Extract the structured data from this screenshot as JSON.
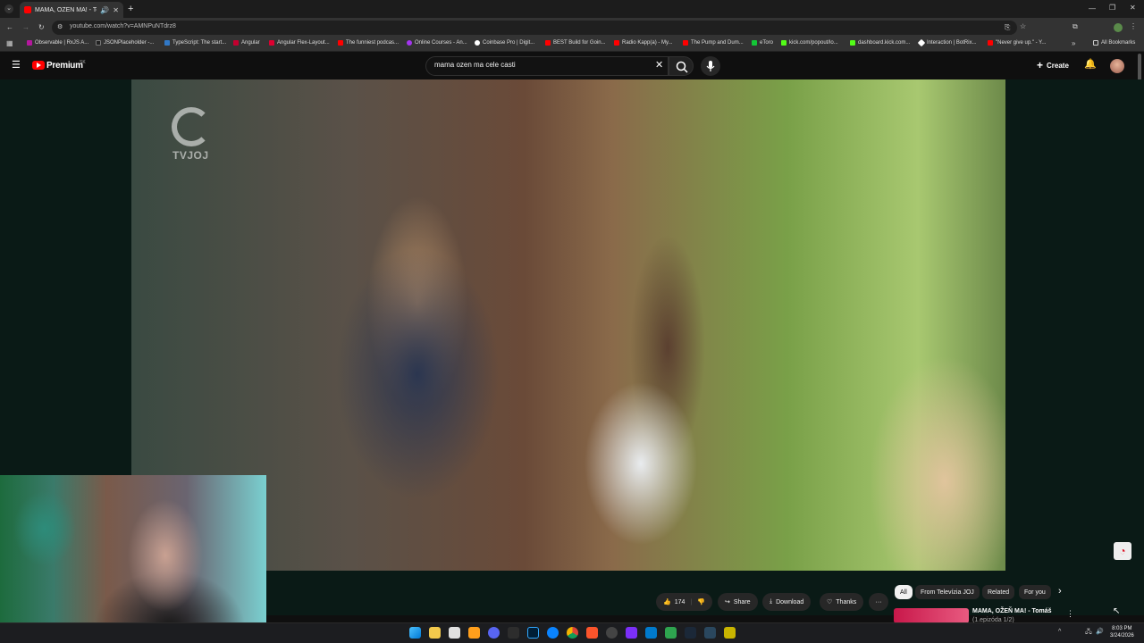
{
  "browser": {
    "tab_title": "MAMA, OŽEŇ MA! - Tomáš",
    "new_tab_symbol": "+",
    "url": "youtube.com/watch?v=AMNPuNTdrz8",
    "all_bookmarks": "All Bookmarks",
    "bookmarks": [
      "Observable | RxJS A...",
      "JSONPlaceholder -...",
      "TypeScript: The start...",
      "Angular",
      "Angular Flex-Layout...",
      "The funniest podcas...",
      "Online Courses - An...",
      "Coinbase Pro | Digit...",
      "BEST Build for Goin...",
      "Radio Kapp(a) - My...",
      "The Pump and Dum...",
      "eToro",
      "kick.com/popout/lo...",
      "dashboard.kick.com...",
      "Interaction | BotRix...",
      "\"Never give up.\" - Y..."
    ]
  },
  "youtube": {
    "logo_text": "Premium",
    "region": "SK",
    "search_value": "mama ozen ma cele casti",
    "create_label": "Create"
  },
  "video": {
    "watermark": "TVJOJ"
  },
  "actions": {
    "likes": "174",
    "share": "Share",
    "download": "Download",
    "thanks": "Thanks",
    "more": "···"
  },
  "chips": [
    "All",
    "From Televízia JOJ",
    "Related",
    "For you"
  ],
  "recommendation": {
    "title": "MAMA, OŽEŇ MA! - Tomáš",
    "subtitle": "(1.epizóda 1/2)"
  },
  "taskbar": {
    "time": "8:03 PM",
    "date": "3/24/2026"
  },
  "colors": {
    "youtube_red": "#ff0000",
    "background": "#0f0f0f",
    "button_bg": "#272727"
  }
}
